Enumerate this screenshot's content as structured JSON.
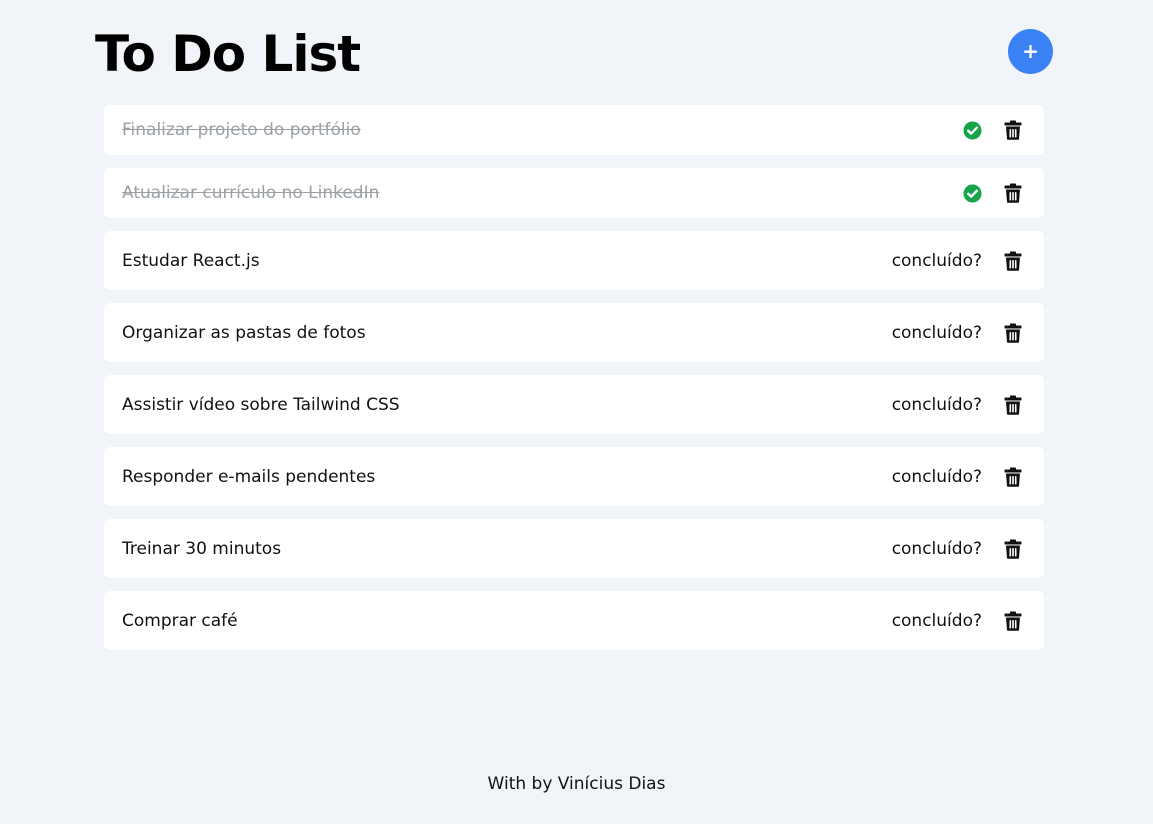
{
  "header": {
    "title": "To Do List",
    "add_label": "+"
  },
  "colors": {
    "background": "#f1f4f9",
    "card": "#ffffff",
    "accent": "#3b82f6",
    "done_check": "#16a34a",
    "done_text": "#9aa0a6"
  },
  "todos": [
    {
      "text": "Finalizar projeto do portfólio",
      "done": true,
      "status_icon": "check-circle-icon",
      "delete_icon": "trash-icon"
    },
    {
      "text": "Atualizar currículo no LinkedIn",
      "done": true,
      "status_icon": "check-circle-icon",
      "delete_icon": "trash-icon"
    },
    {
      "text": "Estudar React.js",
      "done": false,
      "action_label": "concluído?",
      "delete_icon": "trash-icon"
    },
    {
      "text": "Organizar as pastas de fotos",
      "done": false,
      "action_label": "concluído?",
      "delete_icon": "trash-icon"
    },
    {
      "text": "Assistir vídeo sobre Tailwind CSS",
      "done": false,
      "action_label": "concluído?",
      "delete_icon": "trash-icon"
    },
    {
      "text": "Responder e-mails pendentes",
      "done": false,
      "action_label": "concluído?",
      "delete_icon": "trash-icon"
    },
    {
      "text": "Treinar 30 minutos",
      "done": false,
      "action_label": "concluído?",
      "delete_icon": "trash-icon"
    },
    {
      "text": "Comprar café",
      "done": false,
      "action_label": "concluído?",
      "delete_icon": "trash-icon"
    }
  ],
  "footer": {
    "text": "With by Vinícius Dias"
  }
}
